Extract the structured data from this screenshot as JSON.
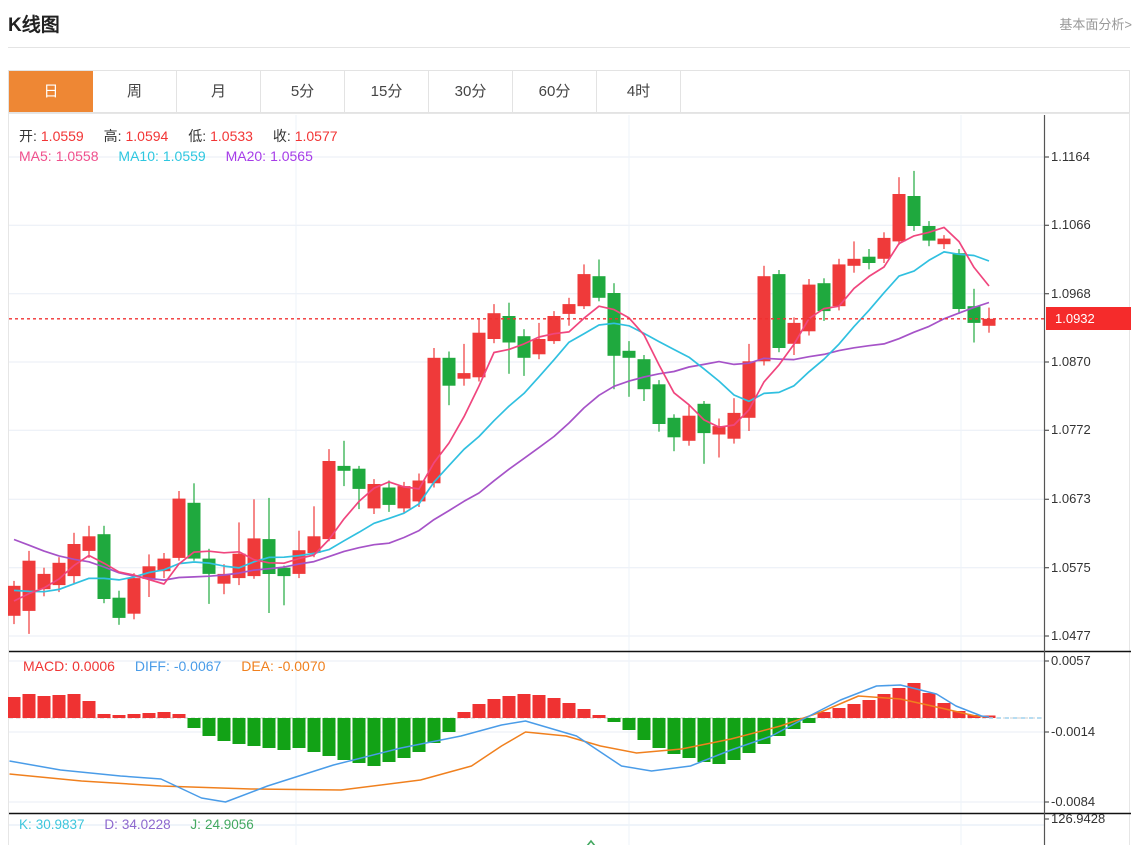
{
  "header": {
    "title": "K线图",
    "link": "基本面分析>"
  },
  "tabs": [
    {
      "name": "tab-day",
      "label": "日",
      "active": true
    },
    {
      "name": "tab-week",
      "label": "周",
      "active": false
    },
    {
      "name": "tab-month",
      "label": "月",
      "active": false
    },
    {
      "name": "tab-5min",
      "label": "5分",
      "active": false
    },
    {
      "name": "tab-15min",
      "label": "15分",
      "active": false
    },
    {
      "name": "tab-30min",
      "label": "30分",
      "active": false
    },
    {
      "name": "tab-60min",
      "label": "60分",
      "active": false
    },
    {
      "name": "tab-4hour",
      "label": "4时",
      "active": false
    }
  ],
  "ohlc": {
    "open": {
      "label": "开:",
      "value": "1.0559"
    },
    "high": {
      "label": "高:",
      "value": "1.0594"
    },
    "low": {
      "label": "低:",
      "value": "1.0533"
    },
    "close": {
      "label": "收:",
      "value": "1.0577"
    }
  },
  "ma": {
    "ma5": {
      "label": "MA5:",
      "value": "1.0558"
    },
    "ma10": {
      "label": "MA10:",
      "value": "1.0559"
    },
    "ma20": {
      "label": "MA20:",
      "value": "1.0565"
    }
  },
  "macd_legend": {
    "macd": {
      "label": "MACD:",
      "value": "0.0006"
    },
    "diff": {
      "label": "DIFF:",
      "value": "-0.0067"
    },
    "dea": {
      "label": "DEA:",
      "value": "-0.0070"
    }
  },
  "kdj_legend": {
    "k": {
      "label": "K:",
      "value": "30.9837"
    },
    "d": {
      "label": "D:",
      "value": "34.0228"
    },
    "j": {
      "label": "J:",
      "value": "24.9056"
    }
  },
  "price_badge": "1.0932",
  "chart_data": {
    "type": "candlestick",
    "main": {
      "ylim": [
        1.0477,
        1.1164
      ],
      "yticks": [
        "1.1164",
        "1.1066",
        "1.0968",
        "1.0870",
        "1.0772",
        "1.0673",
        "1.0575",
        "1.0477"
      ],
      "price_line": 1.0932,
      "up_color": "#ef3a3a",
      "down_color": "#1fa93e",
      "ma5_color": "#f0467e",
      "ma10_color": "#30c0e0",
      "ma20_color": "#a653c8",
      "ma_history_closes": [
        1.075,
        1.0735,
        1.072,
        1.0705,
        1.0692,
        1.068,
        1.0668,
        1.0655,
        1.0645,
        1.0635,
        1.06,
        1.057,
        1.0548,
        1.053,
        1.054,
        1.0532,
        1.0525,
        1.0518,
        1.0512
      ],
      "candles": [
        [
          1.0506,
          1.0549,
          1.0494,
          1.0556
        ],
        [
          1.0513,
          1.0585,
          1.048,
          1.0599
        ],
        [
          1.0544,
          1.0566,
          1.0534,
          1.0575
        ],
        [
          1.055,
          1.0582,
          1.054,
          1.059
        ],
        [
          1.0563,
          1.0609,
          1.0553,
          1.0625
        ],
        [
          1.0599,
          1.062,
          1.0589,
          1.0635
        ],
        [
          1.0623,
          1.053,
          1.0524,
          1.0635
        ],
        [
          1.0532,
          1.0503,
          1.0493,
          1.0542
        ],
        [
          1.0509,
          1.056,
          1.0501,
          1.0567
        ],
        [
          1.0559,
          1.0577,
          1.0533,
          1.0594
        ],
        [
          1.057,
          1.0588,
          1.056,
          1.0596
        ],
        [
          1.0589,
          1.0674,
          1.0585,
          1.0685
        ],
        [
          1.0668,
          1.0588,
          1.0585,
          1.0696
        ],
        [
          1.0588,
          1.0566,
          1.0523,
          1.0602
        ],
        [
          1.0552,
          1.0566,
          1.0537,
          1.058
        ],
        [
          1.056,
          1.0595,
          1.055,
          1.064
        ],
        [
          1.0563,
          1.0617,
          1.0559,
          1.0673
        ],
        [
          1.0616,
          1.0566,
          1.051,
          1.0675
        ],
        [
          1.0575,
          1.0563,
          1.0521,
          1.0578
        ],
        [
          1.0566,
          1.06,
          1.056,
          1.0628
        ],
        [
          1.0596,
          1.062,
          1.059,
          1.0663
        ],
        [
          1.0616,
          1.0728,
          1.0613,
          1.0745
        ],
        [
          1.0721,
          1.0714,
          1.0692,
          1.0757
        ],
        [
          1.0717,
          1.0688,
          1.0659,
          1.0721
        ],
        [
          1.066,
          1.0695,
          1.0652,
          1.0702
        ],
        [
          1.069,
          1.0665,
          1.0655,
          1.07
        ],
        [
          1.066,
          1.0692,
          1.0654,
          1.0698
        ],
        [
          1.067,
          1.07,
          1.0662,
          1.071
        ],
        [
          1.0696,
          1.0876,
          1.069,
          1.089
        ],
        [
          1.0876,
          1.0836,
          1.0808,
          1.0885
        ],
        [
          1.0846,
          1.0854,
          1.0836,
          1.0896
        ],
        [
          1.0848,
          1.0912,
          1.0842,
          1.0932
        ],
        [
          1.0903,
          1.094,
          1.0897,
          1.0953
        ],
        [
          1.0936,
          1.0898,
          1.0853,
          1.0955
        ],
        [
          1.0907,
          1.0876,
          1.085,
          1.0917
        ],
        [
          1.0881,
          1.0903,
          1.0874,
          1.0926
        ],
        [
          1.09,
          1.0936,
          1.0896,
          1.0943
        ],
        [
          1.0939,
          1.0953,
          1.0922,
          1.0962
        ],
        [
          1.095,
          1.0996,
          1.0946,
          1.101
        ],
        [
          1.0993,
          1.0962,
          1.0957,
          1.1017
        ],
        [
          1.0969,
          1.0879,
          1.0831,
          1.0983
        ],
        [
          1.0886,
          1.0876,
          1.082,
          1.09
        ],
        [
          1.0874,
          1.0831,
          1.0814,
          1.088
        ],
        [
          1.0838,
          1.0781,
          1.077,
          1.0844
        ],
        [
          1.079,
          1.0762,
          1.0742,
          1.0795
        ],
        [
          1.0757,
          1.0793,
          1.075,
          1.0809
        ],
        [
          1.081,
          1.0768,
          1.0724,
          1.0814
        ],
        [
          1.0766,
          1.0778,
          1.0733,
          1.0789
        ],
        [
          1.076,
          1.0797,
          1.0753,
          1.0818
        ],
        [
          1.079,
          1.0871,
          1.0771,
          1.0896
        ],
        [
          1.0871,
          1.0993,
          1.0865,
          1.1008
        ],
        [
          1.0996,
          1.089,
          1.0884,
          1.1002
        ],
        [
          1.0896,
          1.0926,
          1.088,
          1.0934
        ],
        [
          1.0914,
          1.0981,
          1.0908,
          1.0989
        ],
        [
          1.0983,
          1.0943,
          1.0929,
          1.099
        ],
        [
          1.095,
          1.101,
          1.0944,
          1.1018
        ],
        [
          1.1008,
          1.1018,
          1.0998,
          1.1043
        ],
        [
          1.1021,
          1.1012,
          1.1003,
          1.1032
        ],
        [
          1.1018,
          1.1048,
          1.1012,
          1.1056
        ],
        [
          1.1043,
          1.1111,
          1.1038,
          1.1135
        ],
        [
          1.1108,
          1.1065,
          1.1058,
          1.1144
        ],
        [
          1.1065,
          1.1044,
          1.1036,
          1.1072
        ],
        [
          1.1039,
          1.1047,
          1.1032,
          1.1052
        ],
        [
          1.1026,
          1.0946,
          1.0939,
          1.1032
        ],
        [
          1.095,
          1.0926,
          1.0898,
          1.0975
        ],
        [
          1.0922,
          1.0932,
          1.0912,
          1.0948
        ]
      ]
    },
    "macd": {
      "yticks": [
        "0.0057",
        "-0.0014",
        "-0.0084"
      ],
      "up_color": "#ef3232",
      "down_color": "#12a216",
      "diff_color": "#4a9ce8",
      "dea_color": "#f0801e",
      "hist": [
        0.0021,
        0.0024,
        0.0022,
        0.0023,
        0.0024,
        0.0017,
        0.0004,
        0.0003,
        0.0004,
        0.0005,
        0.0006,
        0.0004,
        -0.001,
        -0.0018,
        -0.0023,
        -0.0026,
        -0.0028,
        -0.003,
        -0.0032,
        -0.003,
        -0.0034,
        -0.0038,
        -0.0042,
        -0.0045,
        -0.0048,
        -0.0044,
        -0.004,
        -0.0034,
        -0.0025,
        -0.0014,
        0.0006,
        0.0014,
        0.0019,
        0.0022,
        0.0024,
        0.0023,
        0.002,
        0.0015,
        0.0009,
        0.0003,
        -0.0004,
        -0.0012,
        -0.0022,
        -0.003,
        -0.0036,
        -0.004,
        -0.0044,
        -0.0046,
        -0.0042,
        -0.0035,
        -0.0026,
        -0.0018,
        -0.0011,
        -0.0005,
        0.0006,
        0.001,
        0.0014,
        0.0018,
        0.0024,
        0.003,
        0.0035,
        0.0025,
        0.0015,
        0.0007,
        0.0003,
        0.0002
      ],
      "diff_points": [
        [
          0.7,
          -0.0043
        ],
        [
          4.1,
          -0.0052
        ],
        [
          8.1,
          -0.0058
        ],
        [
          10.8,
          -0.0061
        ],
        [
          13.5,
          -0.008
        ],
        [
          15.1,
          -0.0084
        ],
        [
          17.9,
          -0.0068
        ],
        [
          22.3,
          -0.0047
        ],
        [
          26.8,
          -0.003
        ],
        [
          30.8,
          -0.0018
        ],
        [
          33.5,
          -0.0007
        ],
        [
          35.1,
          -0.0003
        ],
        [
          38.5,
          -0.0018
        ],
        [
          41.5,
          -0.0048
        ],
        [
          43.5,
          -0.0053
        ],
        [
          46.1,
          -0.0048
        ],
        [
          48.8,
          -0.0032
        ],
        [
          51.5,
          -0.0018
        ],
        [
          53.5,
          -0.0002
        ],
        [
          56.1,
          0.0018
        ],
        [
          58.5,
          0.0032
        ],
        [
          60.1,
          0.0033
        ],
        [
          62.5,
          0.0024
        ],
        [
          63.8,
          0.0012
        ],
        [
          65.5,
          0.0002
        ],
        [
          66,
          0.0001
        ]
      ],
      "dea_points": [
        [
          0.7,
          -0.0056
        ],
        [
          5.5,
          -0.0063
        ],
        [
          10.8,
          -0.0068
        ],
        [
          16.8,
          -0.0071
        ],
        [
          22.8,
          -0.0072
        ],
        [
          28.1,
          -0.0062
        ],
        [
          31.5,
          -0.0048
        ],
        [
          33.5,
          -0.0028
        ],
        [
          35.1,
          -0.0014
        ],
        [
          37.8,
          -0.0018
        ],
        [
          40.1,
          -0.0028
        ],
        [
          42.5,
          -0.0035
        ],
        [
          45.5,
          -0.0031
        ],
        [
          48.8,
          -0.0021
        ],
        [
          52.1,
          -0.0008
        ],
        [
          54.8,
          0.0006
        ],
        [
          57.3,
          0.0022
        ],
        [
          60.1,
          0.0019
        ],
        [
          62.8,
          0.001
        ],
        [
          65.1,
          0.0002
        ],
        [
          66,
          0.0001
        ]
      ]
    },
    "kdj": {
      "ytick": "126.9428",
      "k_color": "#3ec6dc",
      "d_color": "#8d68ce",
      "j_color": "#43a860"
    }
  }
}
